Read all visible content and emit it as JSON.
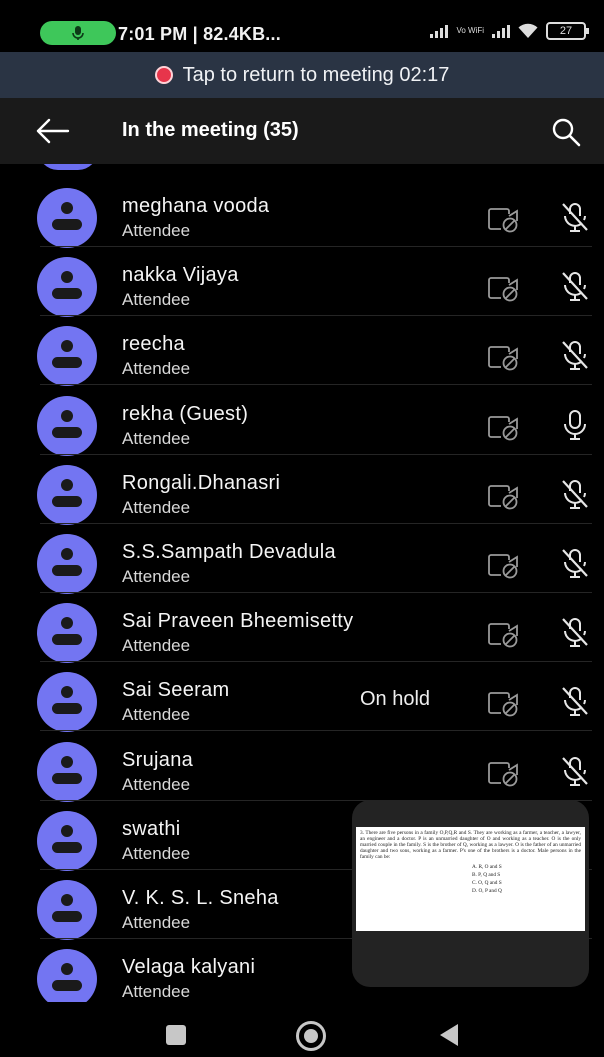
{
  "status_bar": {
    "text": "7:01 PM | 82.4KB...",
    "vowifi": "Vo WiFi",
    "battery": "27"
  },
  "banner": {
    "text": "Tap to return to meeting 02:17"
  },
  "header": {
    "title": "In the meeting (35)"
  },
  "participants": [
    {
      "name": "meghana vooda",
      "role": "Attendee",
      "status": "",
      "mic": "muted"
    },
    {
      "name": "nakka Vijaya",
      "role": "Attendee",
      "status": "",
      "mic": "muted"
    },
    {
      "name": "reecha",
      "role": "Attendee",
      "status": "",
      "mic": "muted"
    },
    {
      "name": "rekha (Guest)",
      "role": "Attendee",
      "status": "",
      "mic": "on"
    },
    {
      "name": "Rongali.Dhanasri",
      "role": "Attendee",
      "status": "",
      "mic": "muted"
    },
    {
      "name": "S.S.Sampath Devadula",
      "role": "Attendee",
      "status": "",
      "mic": "muted"
    },
    {
      "name": "Sai Praveen Bheemisetty",
      "role": "Attendee",
      "status": "",
      "mic": "muted"
    },
    {
      "name": "Sai Seeram",
      "role": "Attendee",
      "status": "On hold",
      "mic": "muted"
    },
    {
      "name": "Srujana",
      "role": "Attendee",
      "status": "",
      "mic": "muted"
    },
    {
      "name": "swathi",
      "role": "Attendee",
      "status": "",
      "mic": "hidden"
    },
    {
      "name": "V. K. S. L. Sneha",
      "role": "Attendee",
      "status": "",
      "mic": "hidden"
    },
    {
      "name": "Velaga kalyani",
      "role": "Attendee",
      "status": "",
      "mic": "hidden"
    }
  ],
  "share_preview": {
    "question": "3. There are five persons in a family O,P,Q,R and S. They are working as a farmer, a teacher, a lawyer, an engineer and a doctor. P is an unmarried daughter of O and working as a teacher. O is the only married couple in the family. S is the brother of Q, working as a lawyer. O is the father of an unmarried daughter and two sons, working as a farmer. P's one of the brothers is a doctor. Male persons in the family can be:",
    "options": [
      "A. R, O and S",
      "B. P, Q and S",
      "C. O, Q and S",
      "D. O, P and Q"
    ]
  },
  "colors": {
    "avatar": "#7375f2",
    "banner_bg": "#2a3444",
    "record_dot": "#e7354b",
    "mic_pill": "#3ec75a"
  }
}
